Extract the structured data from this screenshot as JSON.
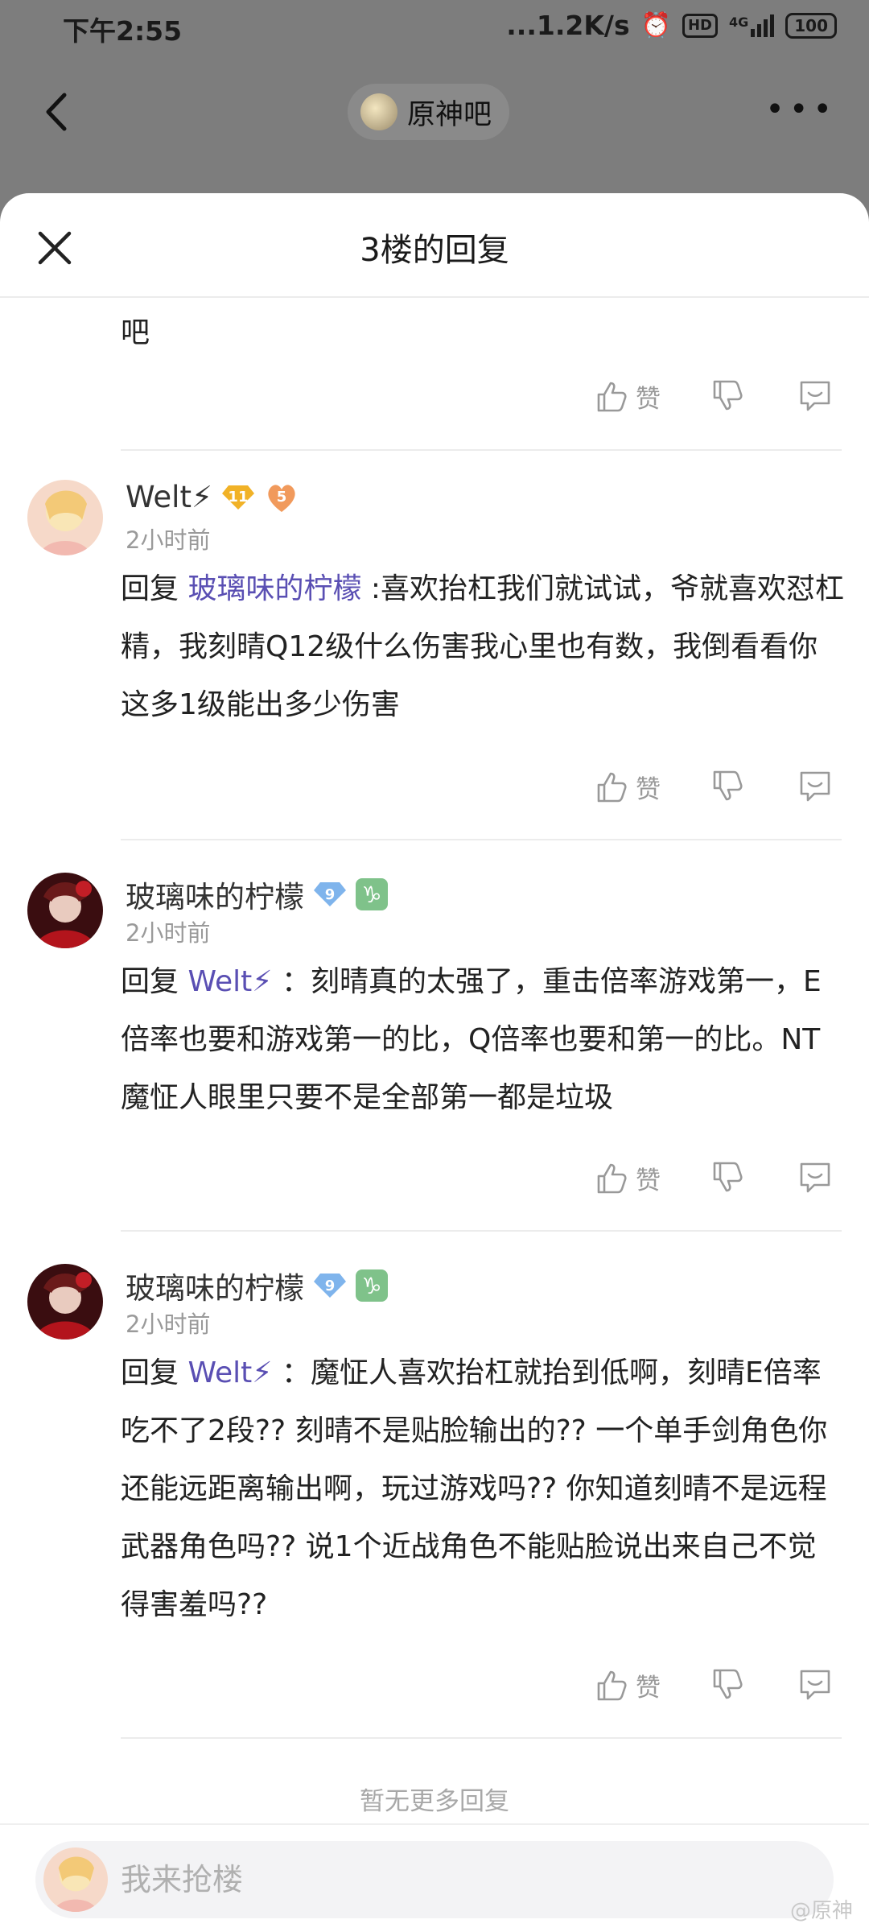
{
  "status_bar": {
    "time": "下午2:55",
    "net_speed": "...1.2K/s",
    "hd": "HD",
    "network": "4G",
    "battery": "100"
  },
  "background_nav": {
    "forum_name": "原神吧",
    "more_label": "•••"
  },
  "sheet": {
    "title": "3楼的回复"
  },
  "partial_reply": {
    "text": "吧",
    "like_label": "赞"
  },
  "replies": [
    {
      "username": "Welt⚡",
      "level": "11",
      "extra_badge": "5",
      "time": "2小时前",
      "reply_prefix": "回复",
      "reply_to": "玻璃味的柠檬",
      "text": " :喜欢抬杠我们就试试，爷就喜欢怼杠精，我刻晴Q12级什么伤害我心里也有数，我倒看看你这多1级能出多少伤害",
      "like_label": "赞"
    },
    {
      "username": "玻璃味的柠檬",
      "level": "9",
      "zodiac": "♑",
      "time": "2小时前",
      "reply_prefix": "回复",
      "reply_to": "Welt⚡",
      "text": " ：刻晴真的太强了，重击倍率游戏第一，E倍率也要和游戏第一的比，Q倍率也要和第一的比。NT魔怔人眼里只要不是全部第一都是垃圾",
      "like_label": "赞"
    },
    {
      "username": "玻璃味的柠檬",
      "level": "9",
      "zodiac": "♑",
      "time": "2小时前",
      "reply_prefix": "回复",
      "reply_to": "Welt⚡",
      "text": " ：魔怔人喜欢抬杠就抬到低啊，刻晴E倍率吃不了2段?? 刻晴不是贴脸输出的?? 一个单手剑角色你还能远距离输出啊，玩过游戏吗?? 你知道刻晴不是远程武器角色吗?? 说1个近战角色不能贴脸说出来自己不觉得害羞吗??",
      "like_label": "赞"
    }
  ],
  "no_more": "暂无更多回复",
  "input": {
    "placeholder": "我来抢楼"
  },
  "watermark": "@原神"
}
